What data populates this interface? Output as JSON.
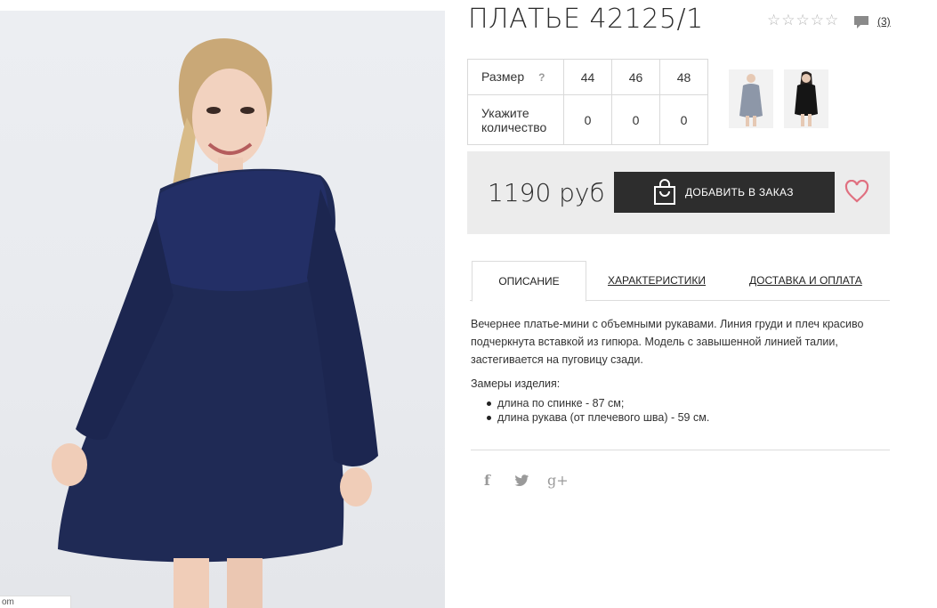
{
  "product": {
    "title": "ПЛАТЬЕ 42125/1",
    "rating_stars": 0,
    "rating_max": 5,
    "reviews_count": "(3)",
    "price": "1190 руб",
    "add_to_cart_label": "ДОБАВИТЬ В ЗАКАЗ"
  },
  "size_table": {
    "size_label": "Размер",
    "help_glyph": "?",
    "qty_label": "Укажите количество",
    "sizes": [
      "44",
      "46",
      "48"
    ],
    "quantities": [
      "0",
      "0",
      "0"
    ]
  },
  "tabs": [
    {
      "label": "ОПИСАНИЕ",
      "active": true
    },
    {
      "label": "ХАРАКТЕРИСТИКИ",
      "active": false
    },
    {
      "label": "ДОСТАВКА И ОПЛАТА",
      "active": false
    }
  ],
  "description": {
    "text": "Вечернее платье-мини с объемными рукавами. Линия груди и плеч красиво подчеркнута вставкой из гипюра. Модель с завышенной линией талии, застегивается на пуговицу сзади.",
    "measurements_title": "Замеры изделия:",
    "measurements": [
      "длина по спинке - 87 см;",
      "длина рукава (от плечевого шва) - 59 см."
    ]
  },
  "social": {
    "facebook_glyph": "f",
    "twitter_glyph": "🐦",
    "google_glyph": "g+"
  },
  "photo_corner_text": "om",
  "colors": {
    "dress": "#1f2a55",
    "button": "#2d2d2d",
    "heart": "#e07080",
    "price_bg": "#ececec"
  }
}
